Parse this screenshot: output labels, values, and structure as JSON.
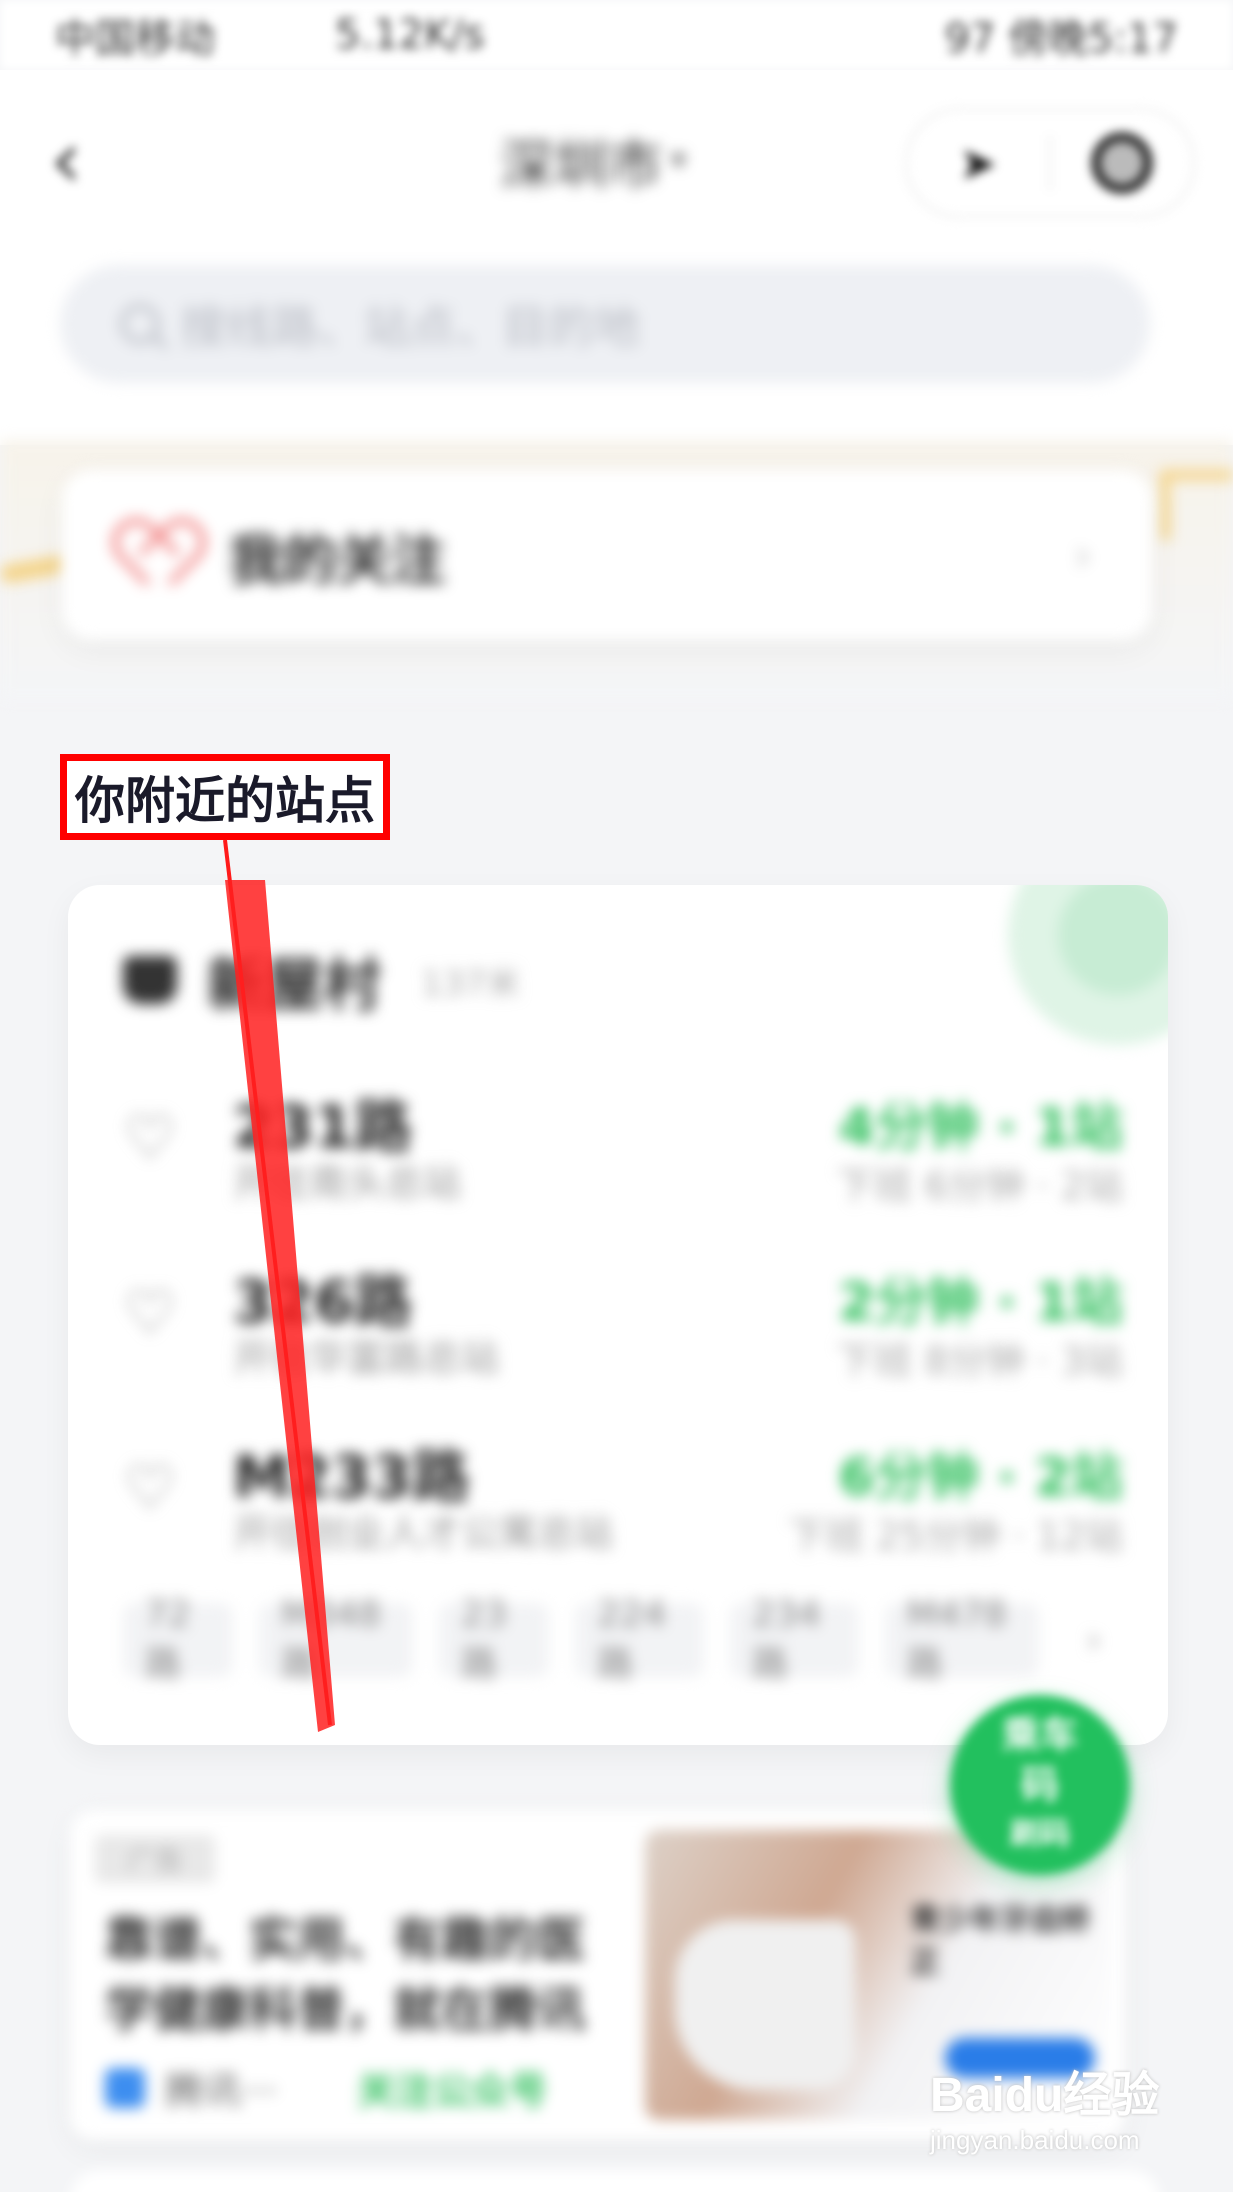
{
  "status_bar": {
    "left": "中国移动",
    "speed": "5.12K/s",
    "right": "97 傍晚5:17"
  },
  "header": {
    "back_label": "‹",
    "city": "深圳市",
    "city_caret": "▾",
    "locate_icon": "➤"
  },
  "search": {
    "placeholder": "搜线路、站点、目的地"
  },
  "follow": {
    "label": "我的关注",
    "arrow": "›"
  },
  "section": {
    "title": "你附近的站点"
  },
  "nearby": {
    "stop_name": "新屋村",
    "stop_distance": "137米",
    "routes": [
      {
        "name": "231路",
        "direction": "开往南头总站",
        "eta": "4分钟 · 1站",
        "next": "下班 6分钟 · 2站"
      },
      {
        "name": "326路",
        "direction": "开往华富路总站",
        "eta": "2分钟 · 1站",
        "next": "下班 8分钟 · 3站"
      },
      {
        "name": "M233路",
        "direction": "开往创业人才公寓总站",
        "eta": "6分钟 · 2站",
        "next": "下班 25分钟 · 12站"
      }
    ],
    "chips": [
      "72路",
      "M348路",
      "23路",
      "224路",
      "234路",
      "M478路"
    ],
    "chip_more": "›"
  },
  "fab": {
    "line1": "乘车",
    "line2": "码",
    "line3": "刷码"
  },
  "ad": {
    "tag": "广告",
    "text_line1": "靠谱、实用、有趣的医",
    "text_line2": "学健康科普，就在腾讯",
    "source": "腾讯···",
    "follow": "关注公众号",
    "image_caption": "青少年牙齿矫正",
    "close": "×"
  },
  "watermark": {
    "top": "Baidu经验",
    "bottom": "jingyan.baidu.com"
  },
  "colors": {
    "accent_green": "#2fbf5c",
    "fab_green": "#22c05e",
    "annotation_red": "#ff0000"
  }
}
